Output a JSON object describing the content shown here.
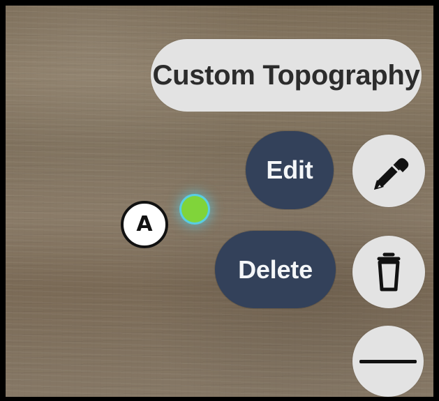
{
  "title": {
    "label": "Custom Topography"
  },
  "actions": {
    "edit_label": "Edit",
    "delete_label": "Delete"
  },
  "annotation": {
    "label": "A"
  },
  "icons": {
    "edit": "pencil-icon",
    "delete": "trash-icon",
    "collapse": "minus-icon"
  },
  "colors": {
    "title_pill": "#e3e3e3",
    "action_pill": "#33415a",
    "point_fill": "#80d43a",
    "point_glow": "#57d0e8"
  }
}
